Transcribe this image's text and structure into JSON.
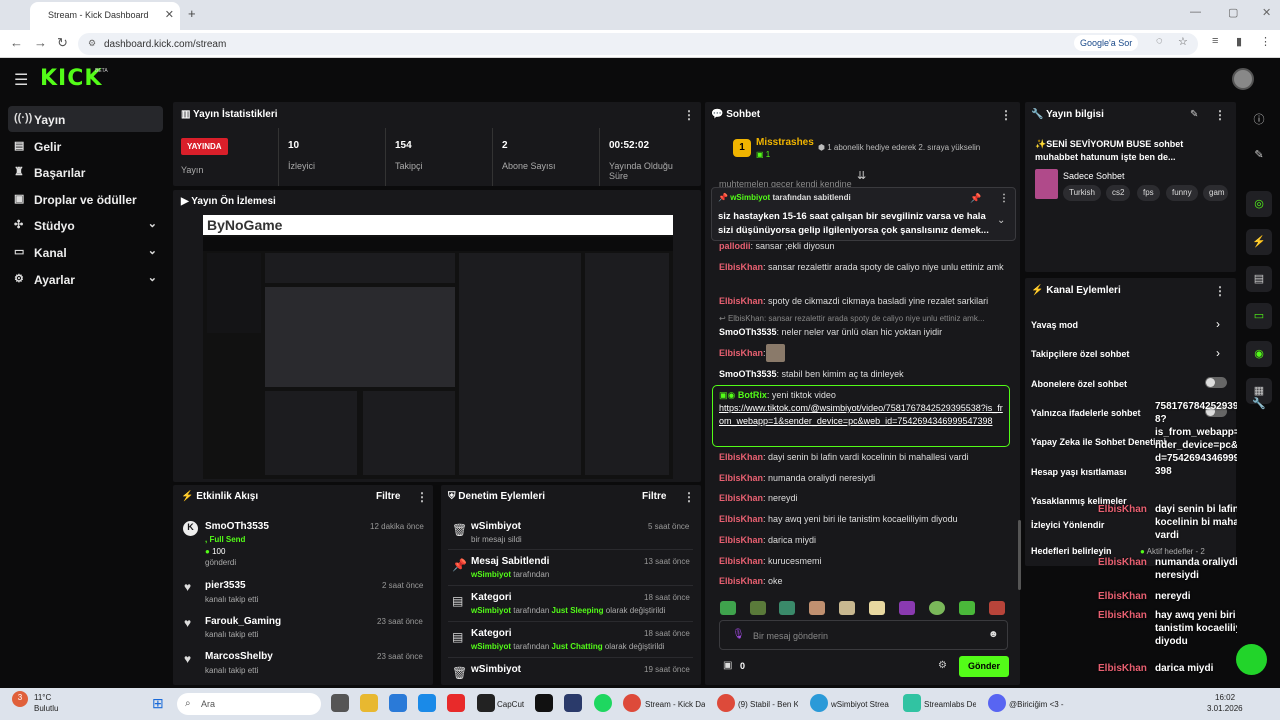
{
  "browser": {
    "tab_title": "Stream - Kick Dashboard",
    "url": "dashboard.kick.com/stream",
    "google_sor": "Google'a Sor"
  },
  "header": {
    "logo": "KICK",
    "beta": "BETA"
  },
  "sidebar": {
    "items": [
      {
        "label": "Yayın",
        "icon": "broadcast-icon",
        "active": true
      },
      {
        "label": "Gelir",
        "icon": "money-icon"
      },
      {
        "label": "Başarılar",
        "icon": "trophy-icon"
      },
      {
        "label": "Droplar ve ödüller",
        "icon": "gift-icon"
      },
      {
        "label": "Stüdyo",
        "icon": "studio-icon",
        "chevron": true
      },
      {
        "label": "Kanal",
        "icon": "tv-icon",
        "chevron": true
      },
      {
        "label": "Ayarlar",
        "icon": "gear-icon",
        "chevron": true
      }
    ]
  },
  "stats": {
    "title": "Yayın İstatistikleri",
    "live_badge": "YAYINDA",
    "live_label": "Yayın",
    "viewers": {
      "value": "10",
      "label": "İzleyici"
    },
    "followers": {
      "value": "154",
      "label": "Takipçi"
    },
    "subs": {
      "value": "2",
      "label": "Abone Sayısı"
    },
    "duration": {
      "value": "00:52:02",
      "label": "Yayında Olduğu Süre"
    }
  },
  "preview": {
    "title": "Yayın Ön İzlemesi",
    "banner": "ByNoGame"
  },
  "events": {
    "title": "Etkinlik Akışı",
    "filter": "Filtre",
    "items": [
      {
        "name": "SmoOTh3535",
        "sub1": ", Full Send",
        "amount": "100",
        "sub2": "gönderdi",
        "time": "12 dakika önce"
      },
      {
        "name": "pier3535",
        "sub1": "kanalı takip etti",
        "time": "2 saat önce"
      },
      {
        "name": "Farouk_Gaming",
        "sub1": "kanalı takip etti",
        "time": "23 saat önce"
      },
      {
        "name": "MarcosShelby",
        "sub1": "kanalı takip etti",
        "time": "23 saat önce"
      }
    ]
  },
  "mod": {
    "title": "Denetim Eylemleri",
    "filter": "Filtre",
    "items": [
      {
        "name": "wSimbiyot",
        "sub": "bir mesajı sildi",
        "time": "5 saat önce"
      },
      {
        "name": "Mesaj Sabitlendi",
        "user": "wSimbiyot",
        "sub": "tarafından",
        "time": "13 saat önce"
      },
      {
        "name": "Kategori",
        "user": "wSimbiyot",
        "sub": "tarafından",
        "cat": "Just Sleeping",
        "sub2": "olarak değiştirildi",
        "time": "18 saat önce"
      },
      {
        "name": "Kategori",
        "user": "wSimbiyot",
        "sub": "tarafından",
        "cat": "Just Chatting",
        "sub2": "olarak değiştirildi",
        "time": "18 saat önce"
      },
      {
        "name": "wSimbiyot",
        "time": "19 saat önce"
      }
    ]
  },
  "chat": {
    "title": "Sohbet",
    "top_user": "Misstrashes",
    "top_rank": "1",
    "gift_note": "1 abonelik hediye ederek 2. sıraya yükselin",
    "faded": "muhtemelen gecer kendi kendine",
    "pinned_by": "wSimbiyot",
    "pinned_label": "tarafından sabitlendi",
    "pinned_text": "siz hastayken 15-16 saat çalışan bir sevgiliniz varsa ve hala sizi düşünüyorsa gelip ilgileniyorsa çok şanslısınız demek...",
    "reply_hint": "ElbisKhan: sansar rezalettir arada spoty de caliyo niye unlu ettiniz amk...",
    "bot_name": "BotRix",
    "bot_text": "yeni tiktok video",
    "bot_link": "https://www.tiktok.com/@wsimbiyot/video/7581767842529395538?is_from_webapp=1&sender_device=pc&web_id=7542694346999547398",
    "messages": [
      {
        "user": "pallodii",
        "text": "sansar ;ekli diyosun",
        "color": "#e86071"
      },
      {
        "user": "ElbisKhan",
        "text": "sansar rezalettir arada spoty de caliyo niye unlu ettiniz amk",
        "color": "#e86071"
      },
      {
        "user": "ElbisKhan",
        "text": "spoty de cikmazdi cikmaya basladi yine rezalet sarkilari",
        "color": "#e86071"
      },
      {
        "user": "SmoOTh3535",
        "text": "neler neler var ünlü olan hic yoktan iyidir",
        "color": "#ffffff"
      },
      {
        "user": "ElbisKhan",
        "text": "",
        "color": "#e86071"
      },
      {
        "user": "SmoOTh3535",
        "text": "stabil ben kimim aç ta dinleyek",
        "color": "#ffffff"
      }
    ],
    "messages2": [
      {
        "user": "ElbisKhan",
        "text": "dayi senin bi lafin vardi kocelinin bi mahallesi vardi"
      },
      {
        "user": "ElbisKhan",
        "text": "numanda oraliydi neresiydi"
      },
      {
        "user": "ElbisKhan",
        "text": "nereydi"
      },
      {
        "user": "ElbisKhan",
        "text": "hay awq yeni biri ile tanistim kocaeliliyim diyodu"
      },
      {
        "user": "ElbisKhan",
        "text": "darica miydi"
      },
      {
        "user": "ElbisKhan",
        "text": "kurucesmemi"
      },
      {
        "user": "ElbisKhan",
        "text": "oke"
      }
    ],
    "input_placeholder": "Bir mesaj gönderin",
    "points": "0",
    "send": "Gönder"
  },
  "info": {
    "title": "Yayın bilgisi",
    "stream_title": "✨SENİ SEVİYORUM BUSE sohbet muhabbet hatunum işte ben de...",
    "category": "Sadece Sohbet",
    "tags": [
      "Turkish",
      "cs2",
      "fps",
      "funny",
      "gam"
    ]
  },
  "actions": {
    "title": "Kanal Eylemleri",
    "items": [
      {
        "label": "Yavaş mod",
        "kind": "chevron"
      },
      {
        "label": "Takipçilere özel sohbet",
        "kind": "chevron"
      },
      {
        "label": "Abonelere özel sohbet",
        "kind": "toggle"
      },
      {
        "label": "Yalnızca ifadelerle sohbet",
        "kind": "toggle"
      },
      {
        "label": "Yapay Zeka ile Sohbet Denetimi",
        "kind": "chevron"
      },
      {
        "label": "Hesap yaşı kısıtlaması",
        "kind": "chevron"
      },
      {
        "label": "Yasaklanmış kelimeler",
        "kind": "chevron"
      },
      {
        "label": "İzleyici Yönlendir",
        "kind": "chevron"
      },
      {
        "label": "Hedefleri belirleyin",
        "kind": "chevron",
        "badge": "Aktif hedefler - 2"
      }
    ]
  },
  "overlay": {
    "link_frag": [
      "758176784252939553",
      "8?",
      "is_from_webapp=1&se",
      "nder_device=pc&web_i",
      "d=75426943469995 47",
      "398"
    ],
    "lines": [
      {
        "user": "ElbisKhan",
        "text": "dayi senin bi lafin vardi kocelinin bi mahallesi vardi"
      },
      {
        "user": "ElbisKhan",
        "text": "numanda oraliydi neresiydi"
      },
      {
        "user": "ElbisKhan",
        "text": "nereydi"
      },
      {
        "user": "ElbisKhan",
        "text": "hay awq yeni biri ile tanistim kocaeliliyim diyodu"
      },
      {
        "user": "ElbisKhan",
        "text": "darica miydi"
      },
      {
        "user": "ElbisKhan",
        "text": "kurucesmemi"
      },
      {
        "user": "ElbisKhan",
        "text": "oke"
      }
    ]
  },
  "taskbar": {
    "weather_temp": "11°C",
    "weather_desc": "Bulutlu",
    "weather_badge": "3",
    "search": "Ara",
    "apps": [
      "CapCut",
      "Stream - Kick Da",
      "(9) Stabil - Ben K",
      "wSimbiyot Strea",
      "Streamlabs De",
      "@Biriciğim <3 -"
    ],
    "time": "16:02",
    "date": "3.01.2026"
  }
}
